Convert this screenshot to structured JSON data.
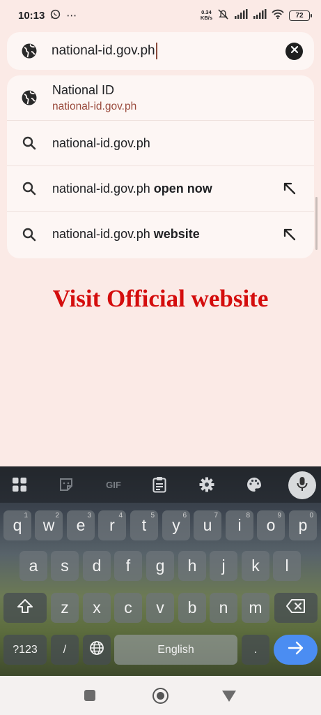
{
  "status_bar": {
    "time": "10:13",
    "speed_value": "0.34",
    "speed_unit": "KB/s",
    "battery": "72",
    "icons": [
      "whatsapp-icon",
      "more-icon",
      "mute-icon",
      "signal-icon",
      "signal-icon",
      "wifi-icon",
      "battery-icon"
    ]
  },
  "url_bar": {
    "value": "national-id.gov.ph",
    "icon": "globe-icon",
    "clear_icon": "close-icon"
  },
  "suggestions": [
    {
      "icon": "globe-icon",
      "title": "National ID",
      "subtitle": "national-id.gov.ph"
    },
    {
      "icon": "search-icon",
      "text": "national-id.gov.ph",
      "bold": ""
    },
    {
      "icon": "search-icon",
      "text": "national-id.gov.ph",
      "bold": " open now",
      "arrow": "arrow-up-left-icon"
    },
    {
      "icon": "search-icon",
      "text": "national-id.gov.ph",
      "bold": " website",
      "arrow": "arrow-up-left-icon"
    }
  ],
  "promo_text": "Visit Official website",
  "keyboard": {
    "toolbar": {
      "gif": "GIF",
      "icons": [
        "apps-icon",
        "sticker-icon",
        "gif-icon",
        "clipboard-icon",
        "settings-icon",
        "palette-icon",
        "mic-icon"
      ]
    },
    "row1": [
      {
        "k": "q",
        "h": "1"
      },
      {
        "k": "w",
        "h": "2"
      },
      {
        "k": "e",
        "h": "3"
      },
      {
        "k": "r",
        "h": "4"
      },
      {
        "k": "t",
        "h": "5"
      },
      {
        "k": "y",
        "h": "6"
      },
      {
        "k": "u",
        "h": "7"
      },
      {
        "k": "i",
        "h": "8"
      },
      {
        "k": "o",
        "h": "9"
      },
      {
        "k": "p",
        "h": "0"
      }
    ],
    "row2": [
      "a",
      "s",
      "d",
      "f",
      "g",
      "h",
      "j",
      "k",
      "l"
    ],
    "row3": [
      "z",
      "x",
      "c",
      "v",
      "b",
      "n",
      "m"
    ],
    "symbols_label": "?123",
    "slash_label": "/",
    "space_label": "English",
    "period_label": "."
  },
  "colors": {
    "page_bg": "#fbeae6",
    "promo": "#d40d0d",
    "subtitle": "#9a4a3c",
    "enter": "#4b8df2"
  }
}
